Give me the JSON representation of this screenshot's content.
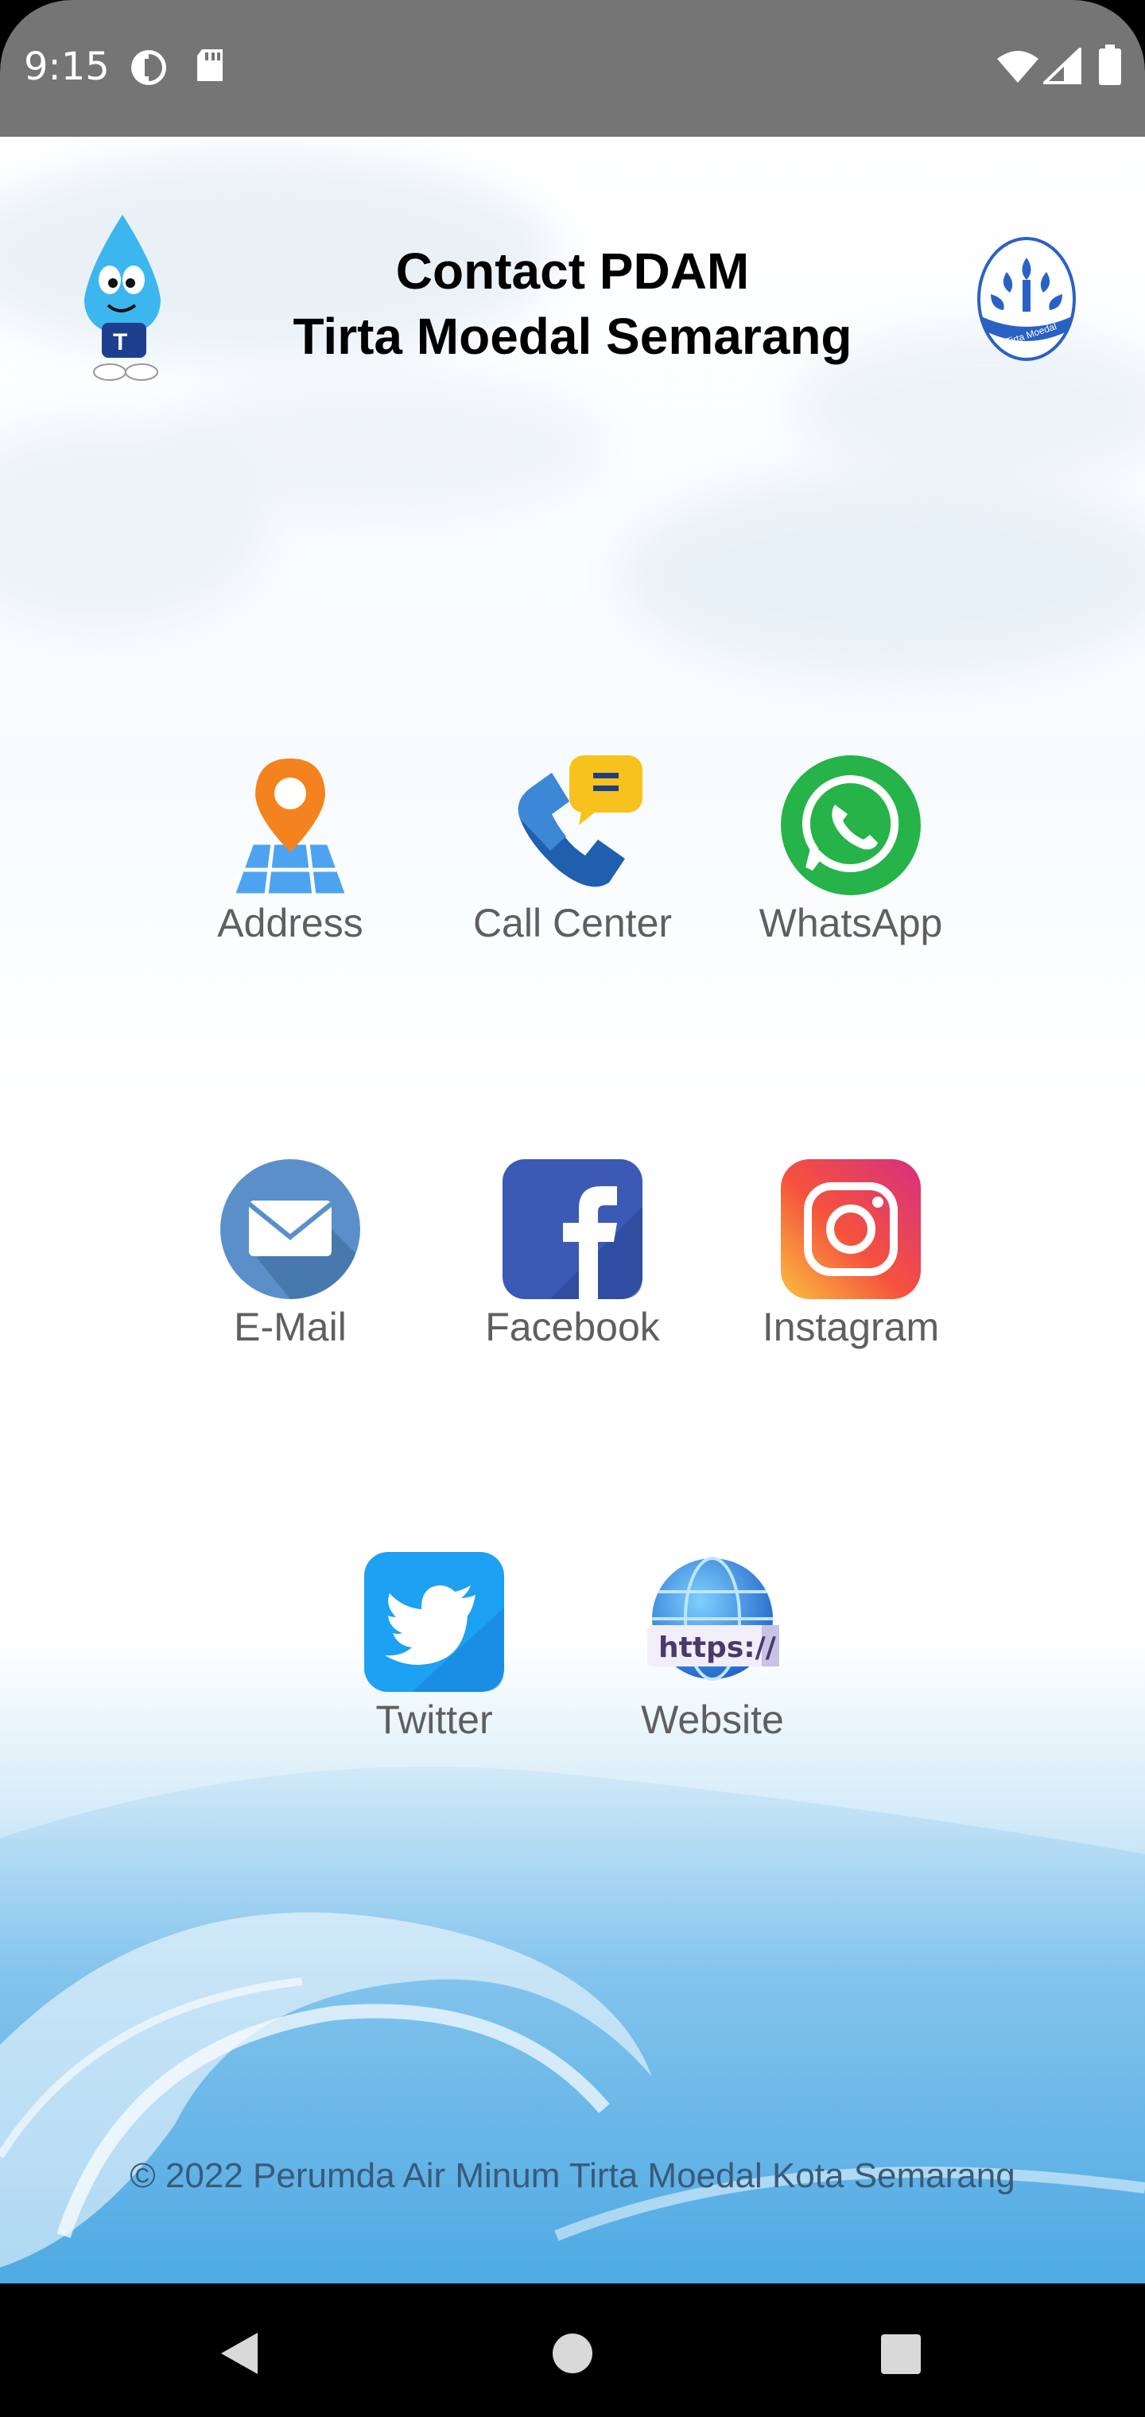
{
  "status_bar": {
    "time": "9:15",
    "left_icons": [
      "data-saver-icon",
      "sd-card-icon"
    ],
    "right_icons": [
      "wifi-icon",
      "signal-icon",
      "battery-icon"
    ]
  },
  "header": {
    "title_line1": "Contact PDAM",
    "title_line2": "Tirta Moedal Semarang",
    "mascot_icon": "water-drop-mascot-icon",
    "logo_icon": "tirta-moedal-logo-icon",
    "logo_text": "Tirta Moedal"
  },
  "contacts": [
    {
      "label": "Address",
      "icon": "map-pin-icon"
    },
    {
      "label": "Call Center",
      "icon": "phone-chat-icon"
    },
    {
      "label": "WhatsApp",
      "icon": "whatsapp-icon"
    },
    {
      "label": "E-Mail",
      "icon": "mail-icon"
    },
    {
      "label": "Facebook",
      "icon": "facebook-icon"
    },
    {
      "label": "Instagram",
      "icon": "instagram-icon"
    },
    {
      "label": "Twitter",
      "icon": "twitter-icon"
    },
    {
      "label": "Website",
      "icon": "globe-https-icon",
      "badge": "https://"
    }
  ],
  "footer": {
    "text": "© 2022 Perumda Air Minum Tirta Moedal Kota Semarang"
  },
  "nav_bar": [
    "back-icon",
    "home-icon",
    "recents-icon"
  ],
  "colors": {
    "status_bar": "#757575",
    "label_text": "#5f5f5f",
    "title_text": "#000000",
    "whatsapp": "#25b34a",
    "facebook": "#3b5ab5",
    "twitter": "#1da1f2",
    "mail": "#5b8fc9",
    "pin": "#f4831f"
  }
}
